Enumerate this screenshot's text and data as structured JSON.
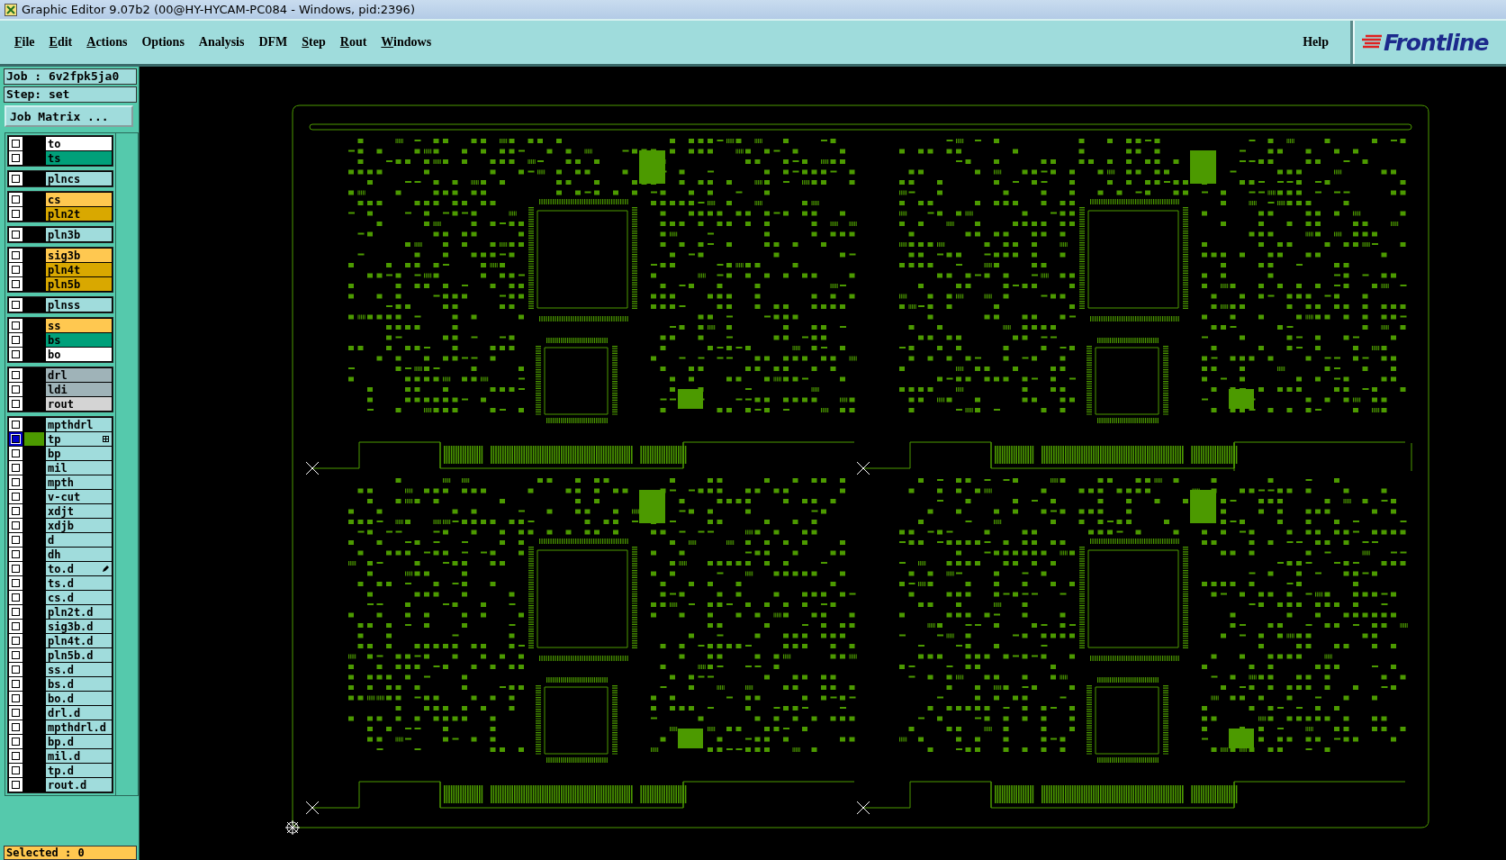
{
  "window": {
    "title": "Graphic Editor 9.07b2 (00@HY-HYCAM-PC084 - Windows, pid:2396)"
  },
  "menu": [
    {
      "label": "File",
      "underlined": true
    },
    {
      "label": "Edit",
      "underlined": true
    },
    {
      "label": "Actions",
      "underlined": true
    },
    {
      "label": "Options",
      "underlined": false
    },
    {
      "label": "Analysis",
      "underlined": false
    },
    {
      "label": "DFM",
      "underlined": false
    },
    {
      "label": "Step",
      "underlined": true
    },
    {
      "label": "Rout",
      "underlined": true
    },
    {
      "label": "Windows",
      "underlined": true
    }
  ],
  "help": {
    "label": "Help"
  },
  "logo": {
    "text": "Frontline"
  },
  "job": {
    "job_line": "Job : 6v2fpk5ja0",
    "step_line": "Step: set",
    "matrix_button": "Job Matrix ..."
  },
  "layer_groups": [
    {
      "layers": [
        {
          "name": "to",
          "color": "#ffffff",
          "selected": false
        },
        {
          "name": "ts",
          "color": "#00a07a",
          "selected": false
        }
      ]
    },
    {
      "layers": [
        {
          "name": "plncs",
          "color": "#a0dcdc",
          "selected": false
        }
      ]
    },
    {
      "layers": [
        {
          "name": "cs",
          "color": "#ffc850",
          "selected": false
        },
        {
          "name": "pln2t",
          "color": "#d9a800",
          "selected": false
        }
      ]
    },
    {
      "layers": [
        {
          "name": "pln3b",
          "color": "#a0dcdc",
          "selected": false
        }
      ]
    },
    {
      "layers": [
        {
          "name": "sig3b",
          "color": "#ffc850",
          "selected": false
        },
        {
          "name": "pln4t",
          "color": "#d9a800",
          "selected": false
        },
        {
          "name": "pln5b",
          "color": "#d9a800",
          "selected": false
        }
      ]
    },
    {
      "layers": [
        {
          "name": "plnss",
          "color": "#a0dcdc",
          "selected": false
        }
      ]
    },
    {
      "layers": [
        {
          "name": "ss",
          "color": "#ffc850",
          "selected": false
        },
        {
          "name": "bs",
          "color": "#00a07a",
          "selected": false
        },
        {
          "name": "bo",
          "color": "#ffffff",
          "selected": false
        }
      ]
    },
    {
      "layers": [
        {
          "name": "drl",
          "color": "#9fb3b8",
          "selected": false
        },
        {
          "name": "ldi",
          "color": "#9fb3b8",
          "selected": false
        },
        {
          "name": "rout",
          "color": "#d4d4d4",
          "selected": false
        }
      ]
    },
    {
      "layers": [
        {
          "name": "mpthdrl",
          "color": "#a0dcdc",
          "selected": false
        },
        {
          "name": "tp",
          "color": "#a0dcdc",
          "selected": true,
          "kind": "grid"
        },
        {
          "name": "bp",
          "color": "#a0dcdc",
          "selected": false
        },
        {
          "name": "mil",
          "color": "#a0dcdc",
          "selected": false
        },
        {
          "name": "mpth",
          "color": "#a0dcdc",
          "selected": false
        },
        {
          "name": "v-cut",
          "color": "#a0dcdc",
          "selected": false
        },
        {
          "name": "xdjt",
          "color": "#a0dcdc",
          "selected": false
        },
        {
          "name": "xdjb",
          "color": "#a0dcdc",
          "selected": false
        },
        {
          "name": "d",
          "color": "#a0dcdc",
          "selected": false
        },
        {
          "name": "dh",
          "color": "#a0dcdc",
          "selected": false
        },
        {
          "name": "to.d",
          "color": "#a0dcdc",
          "selected": false,
          "kind": "pen"
        },
        {
          "name": "ts.d",
          "color": "#a0dcdc",
          "selected": false
        },
        {
          "name": "cs.d",
          "color": "#a0dcdc",
          "selected": false
        },
        {
          "name": "pln2t.d",
          "color": "#a0dcdc",
          "selected": false
        },
        {
          "name": "sig3b.d",
          "color": "#a0dcdc",
          "selected": false
        },
        {
          "name": "pln4t.d",
          "color": "#a0dcdc",
          "selected": false
        },
        {
          "name": "pln5b.d",
          "color": "#a0dcdc",
          "selected": false
        },
        {
          "name": "ss.d",
          "color": "#a0dcdc",
          "selected": false
        },
        {
          "name": "bs.d",
          "color": "#a0dcdc",
          "selected": false
        },
        {
          "name": "bo.d",
          "color": "#a0dcdc",
          "selected": false
        },
        {
          "name": "drl.d",
          "color": "#a0dcdc",
          "selected": false
        },
        {
          "name": "mpthdrl.d",
          "color": "#a0dcdc",
          "selected": false
        },
        {
          "name": "bp.d",
          "color": "#a0dcdc",
          "selected": false
        },
        {
          "name": "mil.d",
          "color": "#a0dcdc",
          "selected": false
        },
        {
          "name": "tp.d",
          "color": "#a0dcdc",
          "selected": false
        },
        {
          "name": "rout.d",
          "color": "#a0dcdc",
          "selected": false
        }
      ]
    }
  ],
  "status": {
    "selected_text": "Selected : 0"
  }
}
